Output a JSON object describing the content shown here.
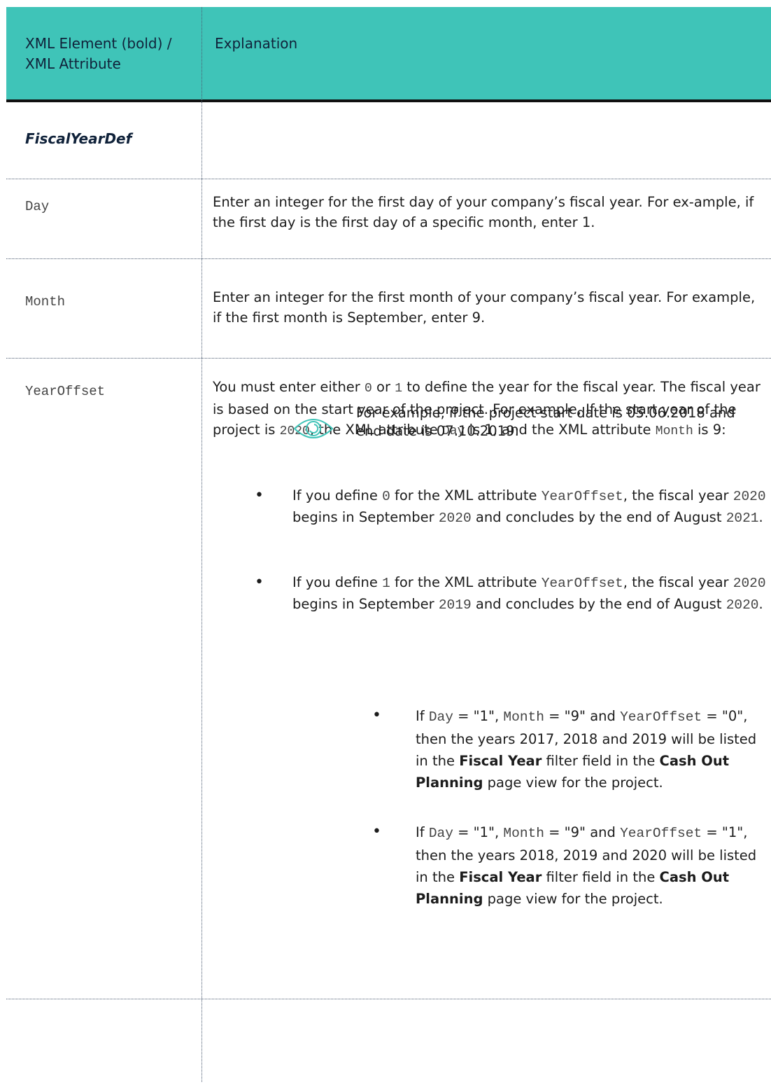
{
  "header": {
    "col1": "XML Element (bold) / XML Attribute",
    "col2": "Explanation"
  },
  "rows": {
    "element_name": "FiscalYearDef",
    "day": {
      "name": "Day",
      "desc": "Enter an integer for the first day of your company’s fiscal year. For ex-ample, if the first day is the first day of a specific month, enter 1."
    },
    "month": {
      "name": "Month",
      "desc": "Enter an integer for the first month of your company’s fiscal year. For example, if the first month is September, enter 9."
    },
    "yearoffset": {
      "name": "YearOffset",
      "intro_1": "You must enter either ",
      "code_0": "0",
      "intro_2": " or ",
      "code_1": "1",
      "intro_3": " to define the year for the fiscal year. The fiscal year is based on the start year of the project. For example, If the start year of the project is ",
      "code_2020": "2020",
      "intro_4": ", the XML attribute ",
      "code_day": "Day",
      "intro_5": " is 1, and the XML attribute ",
      "code_month": "Month",
      "intro_6": " is 9:",
      "bullet1": {
        "t1": "If you define ",
        "c1": "0",
        "t2": " for the XML attribute ",
        "c2": "YearOffset",
        "t3": ", the fiscal year ",
        "c3": "2020",
        "t4": " begins in September ",
        "c4": "2020",
        "t5": " and concludes by the end of August ",
        "c5": "2021",
        "t6": "."
      },
      "bullet2": {
        "t1": "If you define ",
        "c1": "1",
        "t2": " for the XML attribute ",
        "c2": "YearOffset",
        "t3": ", the fiscal year ",
        "c3": "2020",
        "t4": " begins in September ",
        "c4": "2019",
        "t5": " and concludes by the end of August ",
        "c5": "2020",
        "t6": "."
      },
      "note_intro": "For example, if the project start date is 05.06.2018 and end date is 07.10.2019:",
      "note_bullet1": {
        "t1": "If ",
        "c1": "Day",
        "t2": " = \"1\", ",
        "c2": "Month",
        "t3": " = \"9\" and ",
        "c3": "YearOffset",
        "t4": " = \"0\", then the years 2017, 2018 and 2019 will be listed in the ",
        "b1": "Fiscal Year",
        "t5": " filter field in the ",
        "b2": "Cash Out Planning",
        "t6": " page view for the project."
      },
      "note_bullet2": {
        "t1": "If ",
        "c1": "Day",
        "t2": " = \"1\", ",
        "c2": "Month",
        "t3": " = \"9\" and ",
        "c3": "YearOffset",
        "t4": " = \"1\", then the years 2018, 2019 and 2020 will be listed in the ",
        "b1": "Fiscal Year",
        "t5": " filter field in the ",
        "b2": "Cash Out Planning",
        "t6": " page view for the project."
      }
    }
  },
  "colors": {
    "header_bg": "#3fc4b8",
    "header_text": "#10223a",
    "icon": "#3fc4b8"
  },
  "icons": {
    "note": "eye-icon"
  }
}
